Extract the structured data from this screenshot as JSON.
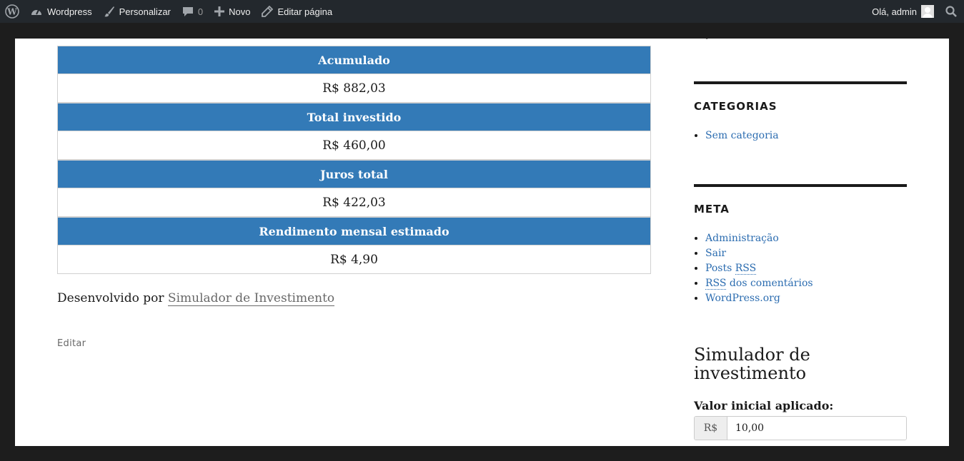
{
  "adminbar": {
    "site_name": "Wordpress",
    "customize": "Personalizar",
    "comments_count": "0",
    "new": "Novo",
    "edit_page": "Editar página",
    "greeting": "Olá, admin"
  },
  "results": [
    {
      "label": "Acumulado",
      "value": "R$ 882,03"
    },
    {
      "label": "Total investido",
      "value": "R$ 460,00"
    },
    {
      "label": "Juros total",
      "value": "R$ 422,03"
    },
    {
      "label": "Rendimento mensal estimado",
      "value": "R$ 4,90"
    }
  ],
  "credit": {
    "prefix": "Desenvolvido por ",
    "link": "Simulador de Investimento"
  },
  "edit_link": "Editar",
  "sidebar": {
    "categories": {
      "title": "CATEGORIAS",
      "items": [
        "Sem categoria"
      ]
    },
    "meta": {
      "title": "META",
      "items": {
        "admin": "Administração",
        "logout": "Sair",
        "posts_rss_prefix": "Posts ",
        "rss": "RSS",
        "comments_rss_suffix": " dos comentários",
        "wordpress_org": "WordPress.org"
      }
    },
    "simulator": {
      "title": "Simulador de investimento",
      "initial_label": "Valor inicial aplicado:",
      "currency": "R$",
      "initial_value": "10,00"
    }
  }
}
